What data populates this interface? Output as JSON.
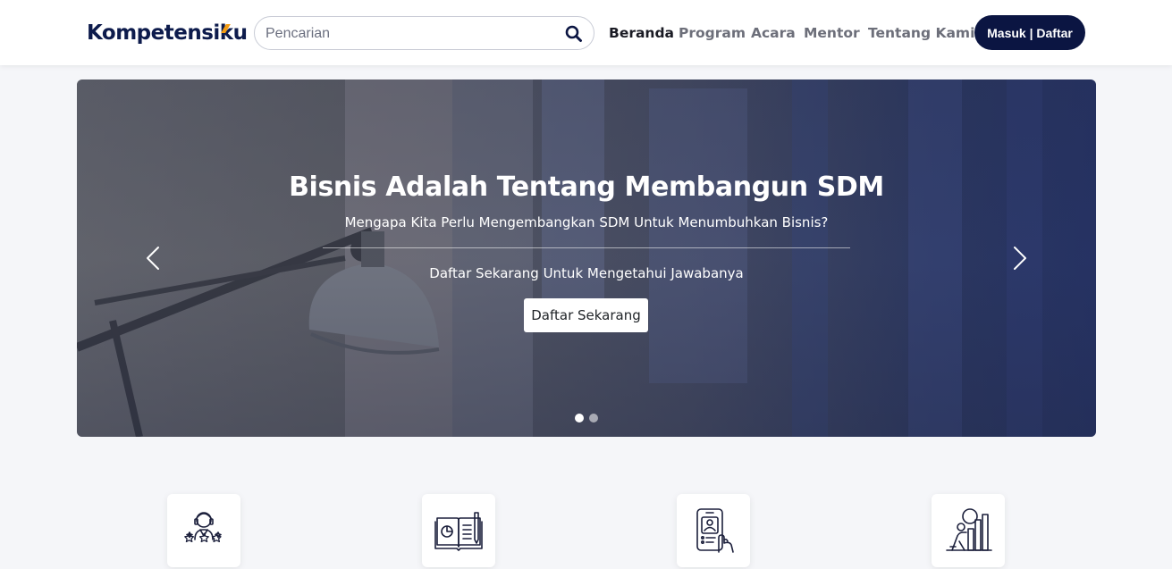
{
  "header": {
    "logo_main": "Kompetensi",
    "logo_end": "ku",
    "search_placeholder": "Pencarian",
    "nav": [
      {
        "label": "Beranda",
        "active": true
      },
      {
        "label": "Program",
        "active": false
      },
      {
        "label": "Acara",
        "active": false
      },
      {
        "label": "Mentor",
        "active": false
      },
      {
        "label": "Tentang Kami",
        "active": false
      }
    ],
    "login_label": "Masuk | Daftar"
  },
  "hero": {
    "title": "Bisnis Adalah Tentang Membangun SDM",
    "subtitle": "Mengapa Kita Perlu Mengembangkan SDM Untuk Menumbuhkan Bisnis?",
    "cta_text": "Daftar Sekarang Untuk Mengetahui Jawabanya",
    "button_label": "Daftar Sekarang",
    "slides_total": 2,
    "active_slide": 1
  },
  "features": [
    {
      "icon": "mentor-person-icon"
    },
    {
      "icon": "book-report-icon"
    },
    {
      "icon": "mobile-profile-icon"
    },
    {
      "icon": "growth-chart-icon"
    }
  ],
  "colors": {
    "brand_navy": "#0b1542",
    "logo_accent": "#f39c12",
    "nav_active": "#1a1b24",
    "nav_inactive": "#6d6f7a",
    "page_bg": "#f5f6f9"
  }
}
